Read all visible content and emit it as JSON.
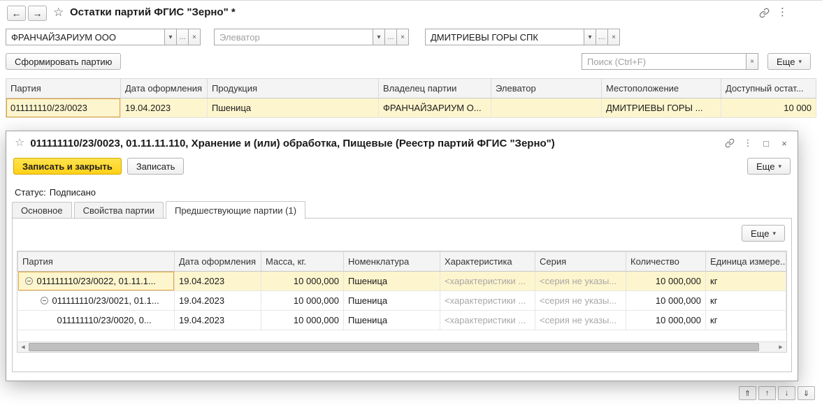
{
  "colors": {
    "accent_yellow": "#ffd117",
    "selection_row": "#fdf5cd",
    "selection_cell": "#ffe686",
    "selection_cell_border": "#dfa23c"
  },
  "icons": {
    "back": "←",
    "forward": "→",
    "favorite": "☆",
    "kebab": "⋮",
    "dropdown": "▾",
    "ellipsis": "…",
    "clear": "×",
    "close": "×",
    "maximize": "□",
    "scroll_left": "◀",
    "scroll_right": "▶",
    "nav_top": "⇑",
    "nav_up": "↑",
    "nav_down": "↓",
    "nav_bottom": "⇓"
  },
  "main_window": {
    "title": "Остатки партий ФГИС \"Зерно\" *",
    "filters": [
      {
        "value": "ФРАНЧАЙЗАРИУМ ООО",
        "placeholder": ""
      },
      {
        "value": "",
        "placeholder": "Элеватор"
      },
      {
        "value": "ДМИТРИЕВЫ ГОРЫ СПК",
        "placeholder": ""
      }
    ],
    "toolbar": {
      "form_batch_button": "Сформировать партию",
      "search_placeholder": "Поиск (Ctrl+F)",
      "more_button": "Еще"
    },
    "list": {
      "columns": [
        "Партия",
        "Дата оформления",
        "Продукция",
        "Владелец партии",
        "Элеватор",
        "Местоположение",
        "Доступный остат..."
      ],
      "row": {
        "batch": "011111110/23/0023",
        "date": "19.04.2023",
        "product": "Пшеница",
        "owner": "ФРАНЧАЙЗАРИУМ О...",
        "elevator": "",
        "location": "ДМИТРИЕВЫ ГОРЫ ...",
        "available": "10 000"
      }
    }
  },
  "dialog": {
    "title": "011111110/23/0023, 01.11.11.110, Хранение и (или) обработка, Пищевые (Реестр партий ФГИС \"Зерно\")",
    "commands": {
      "save_close": "Записать и закрыть",
      "save": "Записать",
      "more": "Еще"
    },
    "status_label": "Статус:",
    "status_value": "Подписано",
    "tabs": [
      "Основное",
      "Свойства партии",
      "Предшествующие партии (1)"
    ],
    "panel_more_button": "Еще",
    "grid": {
      "columns": [
        "Партия",
        "Дата оформления",
        "Масса, кг.",
        "Номенклатура",
        "Характеристика",
        "Серия",
        "Количество",
        "Единица измере..."
      ],
      "rows": [
        {
          "batch": "011111110/23/0022, 01.11.1...",
          "date": "19.04.2023",
          "mass": "10 000,000",
          "nomenclature": "Пшеница",
          "characteristic": "<характеристики ...",
          "series": "<серия не указы...",
          "quantity": "10 000,000",
          "unit": "кг"
        },
        {
          "batch": "011111110/23/0021, 01.1...",
          "date": "19.04.2023",
          "mass": "10 000,000",
          "nomenclature": "Пшеница",
          "characteristic": "<характеристики ...",
          "series": "<серия не указы...",
          "quantity": "10 000,000",
          "unit": "кг"
        },
        {
          "batch": "011111110/23/0020, 0...",
          "date": "19.04.2023",
          "mass": "10 000,000",
          "nomenclature": "Пшеница",
          "characteristic": "<характеристики ...",
          "series": "<серия не указы...",
          "quantity": "10 000,000",
          "unit": "кг"
        }
      ]
    }
  }
}
